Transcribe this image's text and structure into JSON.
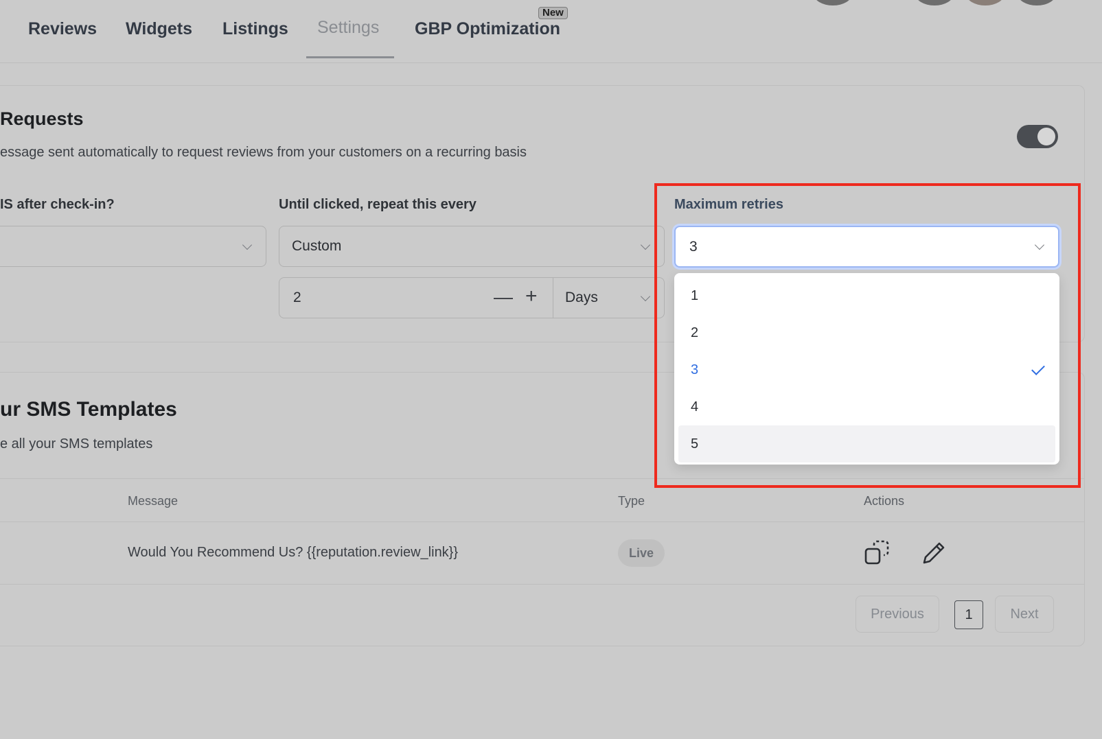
{
  "nav": {
    "tabs": [
      {
        "label": "Reviews"
      },
      {
        "label": "Widgets"
      },
      {
        "label": "Listings"
      },
      {
        "label": "Settings"
      },
      {
        "label": "GBP Optimization"
      }
    ],
    "new_badge": "New"
  },
  "requests": {
    "title": "Requests",
    "description": "essage sent automatically to request reviews from your customers on a recurring basis",
    "after_checkin_label": "IS after check-in?",
    "repeat_label": "Until clicked, repeat this every",
    "repeat_value": "Custom",
    "interval_value": "2",
    "interval_unit": "Days",
    "max_retries_label": "Maximum retries",
    "max_retries_value": "3",
    "retry_options": [
      "1",
      "2",
      "3",
      "4",
      "5"
    ]
  },
  "templates": {
    "title": "ur SMS Templates",
    "description": "e all your SMS templates",
    "columns": {
      "message": "Message",
      "type": "Type",
      "actions": "Actions"
    },
    "rows": [
      {
        "message": "Would You Recommend Us? {{reputation.review_link}}",
        "type": "Live"
      }
    ],
    "pagination": {
      "previous": "Previous",
      "page": "1",
      "next": "Next"
    }
  }
}
